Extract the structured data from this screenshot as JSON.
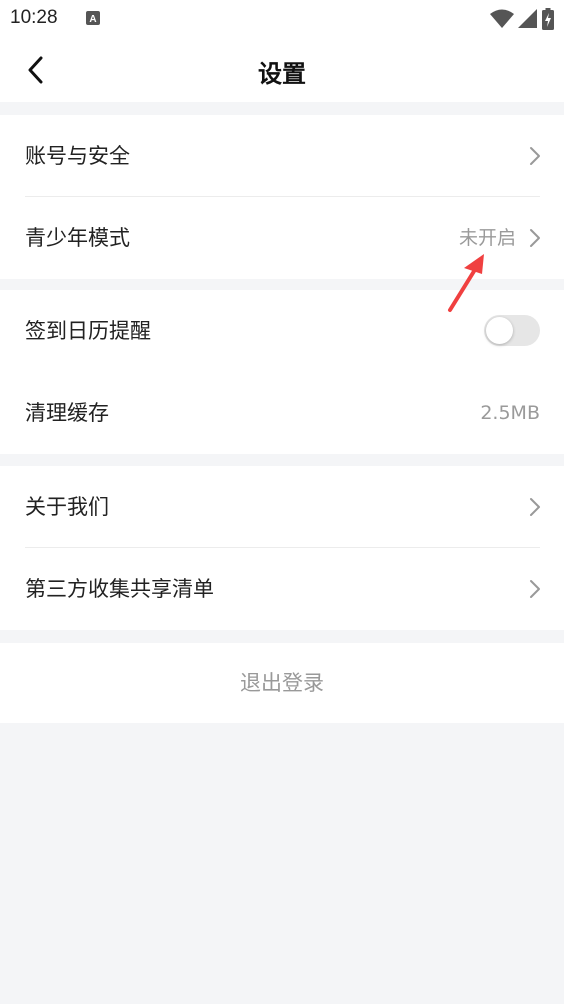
{
  "status_bar": {
    "time": "10:28",
    "icons": [
      "app-a-icon",
      "wifi-icon",
      "cellular-icon",
      "battery-charging-icon"
    ]
  },
  "nav": {
    "title": "设置",
    "back_icon": "chevron-left-icon"
  },
  "groups": [
    {
      "items": [
        {
          "label": "账号与安全",
          "value": "",
          "chevron": true
        },
        {
          "label": "青少年模式",
          "value": "未开启",
          "chevron": true
        }
      ]
    },
    {
      "items": [
        {
          "label": "签到日历提醒",
          "toggle": false
        },
        {
          "label": "清理缓存",
          "value": "2.5MB",
          "chevron": false
        }
      ]
    },
    {
      "items": [
        {
          "label": "关于我们",
          "chevron": true
        },
        {
          "label": "第三方收集共享清单",
          "chevron": true
        }
      ]
    }
  ],
  "logout": {
    "label": "退出登录"
  },
  "annotation": {
    "color": "#f04040"
  }
}
